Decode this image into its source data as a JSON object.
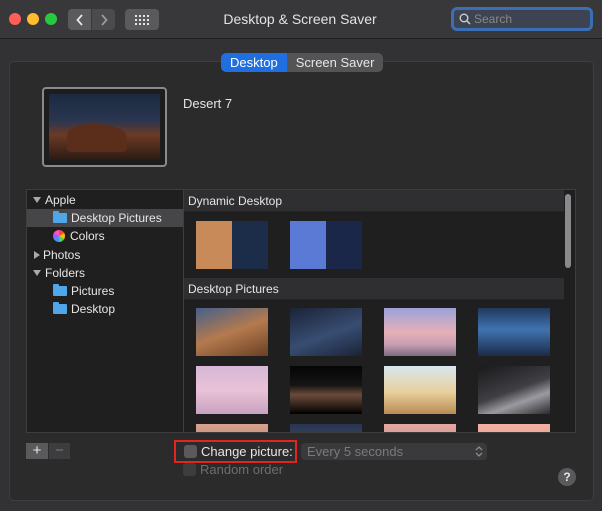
{
  "window": {
    "title": "Desktop & Screen Saver",
    "search_placeholder": "Search"
  },
  "tabs": [
    {
      "label": "Desktop",
      "active": true
    },
    {
      "label": "Screen Saver",
      "active": false
    }
  ],
  "current_wallpaper": {
    "name": "Desert 7"
  },
  "sidebar": {
    "items": [
      {
        "label": "Apple",
        "type": "group",
        "expanded": true
      },
      {
        "label": "Desktop Pictures",
        "type": "folder",
        "selected": true
      },
      {
        "label": "Colors",
        "type": "colors"
      },
      {
        "label": "Photos",
        "type": "group",
        "expanded": false
      },
      {
        "label": "Folders",
        "type": "group",
        "expanded": true
      },
      {
        "label": "Pictures",
        "type": "folder"
      },
      {
        "label": "Desktop",
        "type": "folder"
      }
    ]
  },
  "sections": {
    "dynamic": {
      "title": "Dynamic Desktop"
    },
    "pictures": {
      "title": "Desktop Pictures"
    }
  },
  "controls": {
    "add": "+",
    "remove": "−",
    "change_picture": {
      "label": "Change picture:",
      "checked": false
    },
    "interval": {
      "value": "Every 5 seconds"
    },
    "random_order": {
      "label": "Random order",
      "checked": false,
      "enabled": false
    },
    "help": "?"
  },
  "colors": {
    "accent": "#1f6fe0",
    "highlight_border": "#e0261f"
  }
}
